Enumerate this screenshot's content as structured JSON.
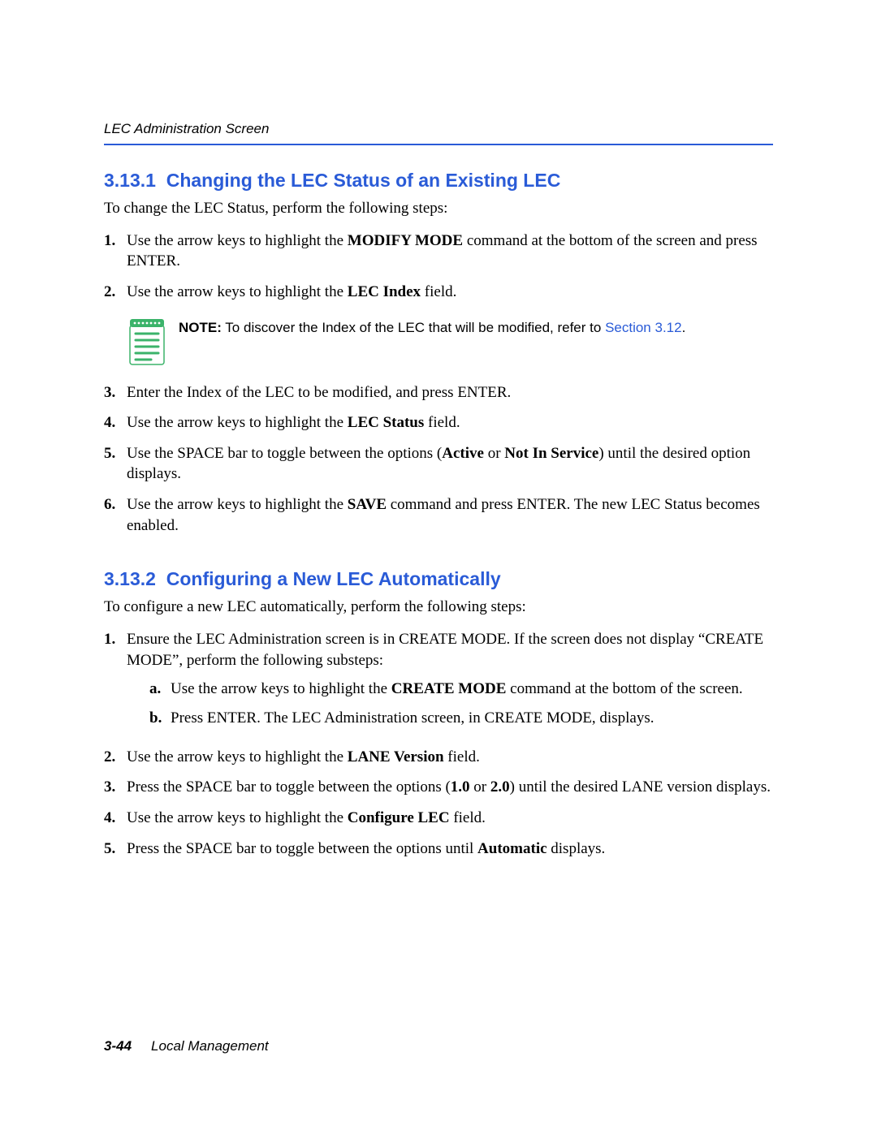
{
  "header": {
    "title": "LEC Administration Screen"
  },
  "footer": {
    "page": "3-44",
    "doc": "Local Management"
  },
  "s1": {
    "number": "3.13.1",
    "title": "Changing the LEC Status of an Existing LEC",
    "intro": "To change the LEC Status, perform the following steps:",
    "step1": {
      "num": "1.",
      "pre": "Use the arrow keys to highlight the ",
      "bold": "MODIFY MODE",
      "post": " command at the bottom of the screen and press ENTER."
    },
    "step2": {
      "num": "2.",
      "pre": "Use the arrow keys to highlight the ",
      "bold": "LEC Index",
      "post": " field."
    },
    "note": {
      "label": "NOTE:",
      "text": " To discover the Index of the LEC that will be modified, refer to ",
      "link": "Section 3.12",
      "tail": "."
    },
    "step3": {
      "num": "3.",
      "text": "Enter the Index of the LEC to be modified, and press ENTER."
    },
    "step4": {
      "num": "4.",
      "pre": "Use the arrow keys to highlight the ",
      "bold": "LEC Status",
      "post": " field."
    },
    "step5": {
      "num": "5.",
      "pre": "Use the SPACE bar to toggle between the options (",
      "bold1": "Active",
      "mid": " or ",
      "bold2": "Not In Service",
      "post": ") until the desired option displays."
    },
    "step6": {
      "num": "6.",
      "pre": "Use the arrow keys to highlight the ",
      "bold": "SAVE",
      "post": " command and press ENTER. The new LEC Status becomes enabled."
    }
  },
  "s2": {
    "number": "3.13.2",
    "title": "Configuring a New LEC Automatically",
    "intro": "To configure a new LEC automatically, perform the following steps:",
    "step1": {
      "num": "1.",
      "text": "Ensure the LEC Administration screen is in CREATE MODE. If the screen does not display “CREATE MODE”, perform the following substeps:",
      "sub_a": {
        "num": "a.",
        "pre": "Use the arrow keys to highlight the ",
        "bold": "CREATE MODE",
        "post": " command at the bottom of the screen."
      },
      "sub_b": {
        "num": "b.",
        "text": "Press ENTER. The LEC Administration screen, in CREATE MODE, displays."
      }
    },
    "step2": {
      "num": "2.",
      "pre": "Use the arrow keys to highlight the ",
      "bold": "LANE Version",
      "post": " field."
    },
    "step3": {
      "num": "3.",
      "pre": "Press the SPACE bar to toggle between the options (",
      "bold1": "1.0",
      "mid": " or ",
      "bold2": "2.0",
      "post": ") until the desired LANE version displays."
    },
    "step4": {
      "num": "4.",
      "pre": "Use the arrow keys to highlight the ",
      "bold": "Configure LEC",
      "post": " field."
    },
    "step5": {
      "num": "5.",
      "pre": "Press the SPACE bar to toggle between the options until ",
      "bold": "Automatic",
      "post": " displays."
    }
  }
}
